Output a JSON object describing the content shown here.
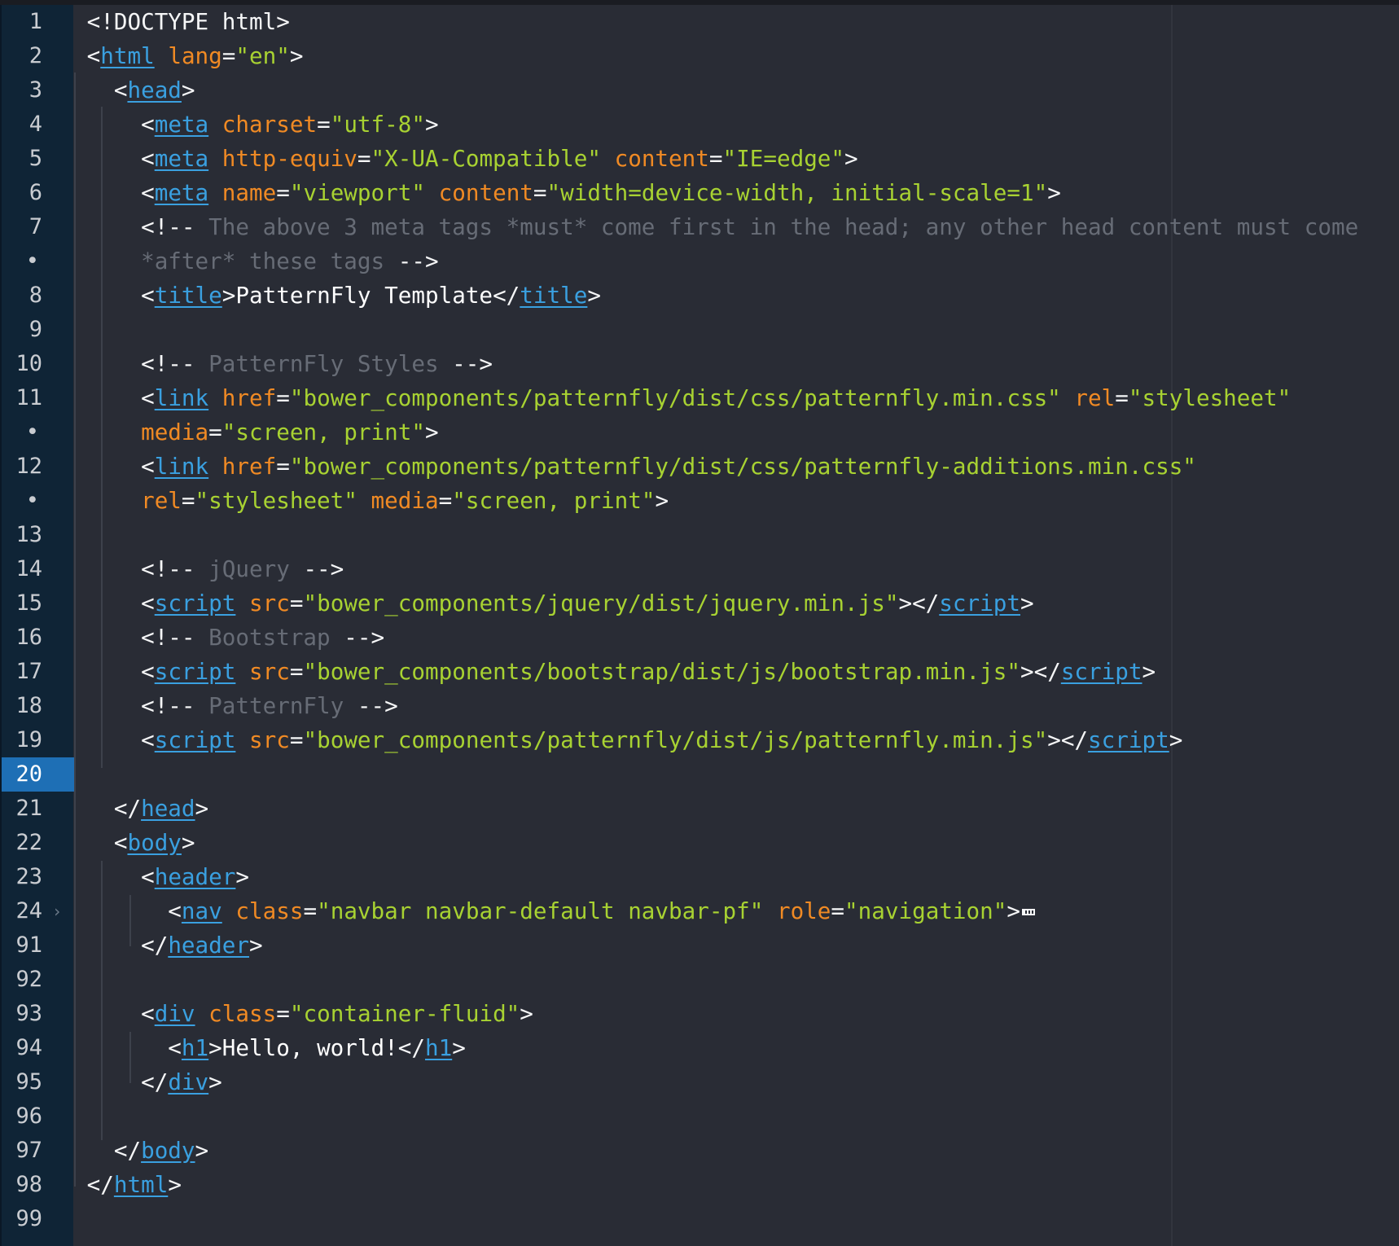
{
  "editor": {
    "language": "html",
    "current_line": "20"
  },
  "gutter": [
    {
      "label": "1"
    },
    {
      "label": "2"
    },
    {
      "label": "3"
    },
    {
      "label": "4"
    },
    {
      "label": "5"
    },
    {
      "label": "6"
    },
    {
      "label": "7"
    },
    {
      "label": "•"
    },
    {
      "label": "8"
    },
    {
      "label": "9"
    },
    {
      "label": "10"
    },
    {
      "label": "11"
    },
    {
      "label": "•"
    },
    {
      "label": "12"
    },
    {
      "label": "•"
    },
    {
      "label": "13"
    },
    {
      "label": "14"
    },
    {
      "label": "15"
    },
    {
      "label": "16"
    },
    {
      "label": "17"
    },
    {
      "label": "18"
    },
    {
      "label": "19"
    },
    {
      "label": "20"
    },
    {
      "label": "21"
    },
    {
      "label": "22"
    },
    {
      "label": "23"
    },
    {
      "label": "24"
    },
    {
      "label": "91"
    },
    {
      "label": "92"
    },
    {
      "label": "93"
    },
    {
      "label": "94"
    },
    {
      "label": "95"
    },
    {
      "label": "96"
    },
    {
      "label": "97"
    },
    {
      "label": "98"
    },
    {
      "label": "99"
    }
  ],
  "code": {
    "l1": {
      "doctype": "<!DOCTYPE html>"
    },
    "l2": {
      "tag": "html",
      "attr1": "lang",
      "val1": "\"en\""
    },
    "l3": {
      "tag": "head"
    },
    "l4": {
      "tag": "meta",
      "attr1": "charset",
      "val1": "\"utf-8\""
    },
    "l5": {
      "tag": "meta",
      "attr1": "http-equiv",
      "val1": "\"X-UA-Compatible\"",
      "attr2": "content",
      "val2": "\"IE=edge\""
    },
    "l6": {
      "tag": "meta",
      "attr1": "name",
      "val1": "\"viewport\"",
      "attr2": "content",
      "val2": "\"width=device-width, initial-scale=1\""
    },
    "l7": {
      "open": "<!--",
      "comment": " The above 3 meta tags *must* come first in the head; any other head content must come"
    },
    "l7b": {
      "comment": "*after* these tags",
      "close": " -->"
    },
    "l8": {
      "tag": "title",
      "text": "PatternFly Template"
    },
    "l10": {
      "open": "<!--",
      "comment": " PatternFly Styles",
      "close": " -->"
    },
    "l11": {
      "tag": "link",
      "attr1": "href",
      "val1": "\"bower_components/patternfly/dist/css/patternfly.min.css\"",
      "attr2": "rel",
      "val2": "\"stylesheet\""
    },
    "l11b": {
      "attr1": "media",
      "val1": "\"screen, print\""
    },
    "l12": {
      "tag": "link",
      "attr1": "href",
      "val1": "\"bower_components/patternfly/dist/css/patternfly-additions.min.css\""
    },
    "l12b": {
      "attr1": "rel",
      "val1": "\"stylesheet\"",
      "attr2": "media",
      "val2": "\"screen, print\""
    },
    "l14": {
      "open": "<!--",
      "comment": " jQuery",
      "close": " -->"
    },
    "l15": {
      "tag": "script",
      "attr1": "src",
      "val1": "\"bower_components/jquery/dist/jquery.min.js\""
    },
    "l16": {
      "open": "<!--",
      "comment": " Bootstrap",
      "close": " -->"
    },
    "l17": {
      "tag": "script",
      "attr1": "src",
      "val1": "\"bower_components/bootstrap/dist/js/bootstrap.min.js\""
    },
    "l18": {
      "open": "<!--",
      "comment": " PatternFly",
      "close": " -->"
    },
    "l19": {
      "tag": "script",
      "attr1": "src",
      "val1": "\"bower_components/patternfly/dist/js/patternfly.min.js\""
    },
    "l21": {
      "tag": "head"
    },
    "l22": {
      "tag": "body"
    },
    "l23": {
      "tag": "header"
    },
    "l24": {
      "tag": "nav",
      "attr1": "class",
      "val1": "\"navbar navbar-default navbar-pf\"",
      "attr2": "role",
      "val2": "\"navigation\""
    },
    "l91": {
      "tag": "header"
    },
    "l93": {
      "tag": "div",
      "attr1": "class",
      "val1": "\"container-fluid\""
    },
    "l94": {
      "tag": "h1",
      "text": "Hello, world!"
    },
    "l95": {
      "tag": "div"
    },
    "l97": {
      "tag": "body"
    },
    "l98": {
      "tag": "html"
    }
  },
  "colors": {
    "background": "#292c35",
    "gutter": "#0f2436",
    "current_line": "#1e6fb5",
    "tag": "#3aa0e0",
    "attribute": "#f08a24",
    "string": "#a8d232",
    "comment": "#676c76"
  },
  "icons": {
    "fold_arrow": "chevron-right-icon",
    "fold_marker": "folded-code-icon"
  }
}
